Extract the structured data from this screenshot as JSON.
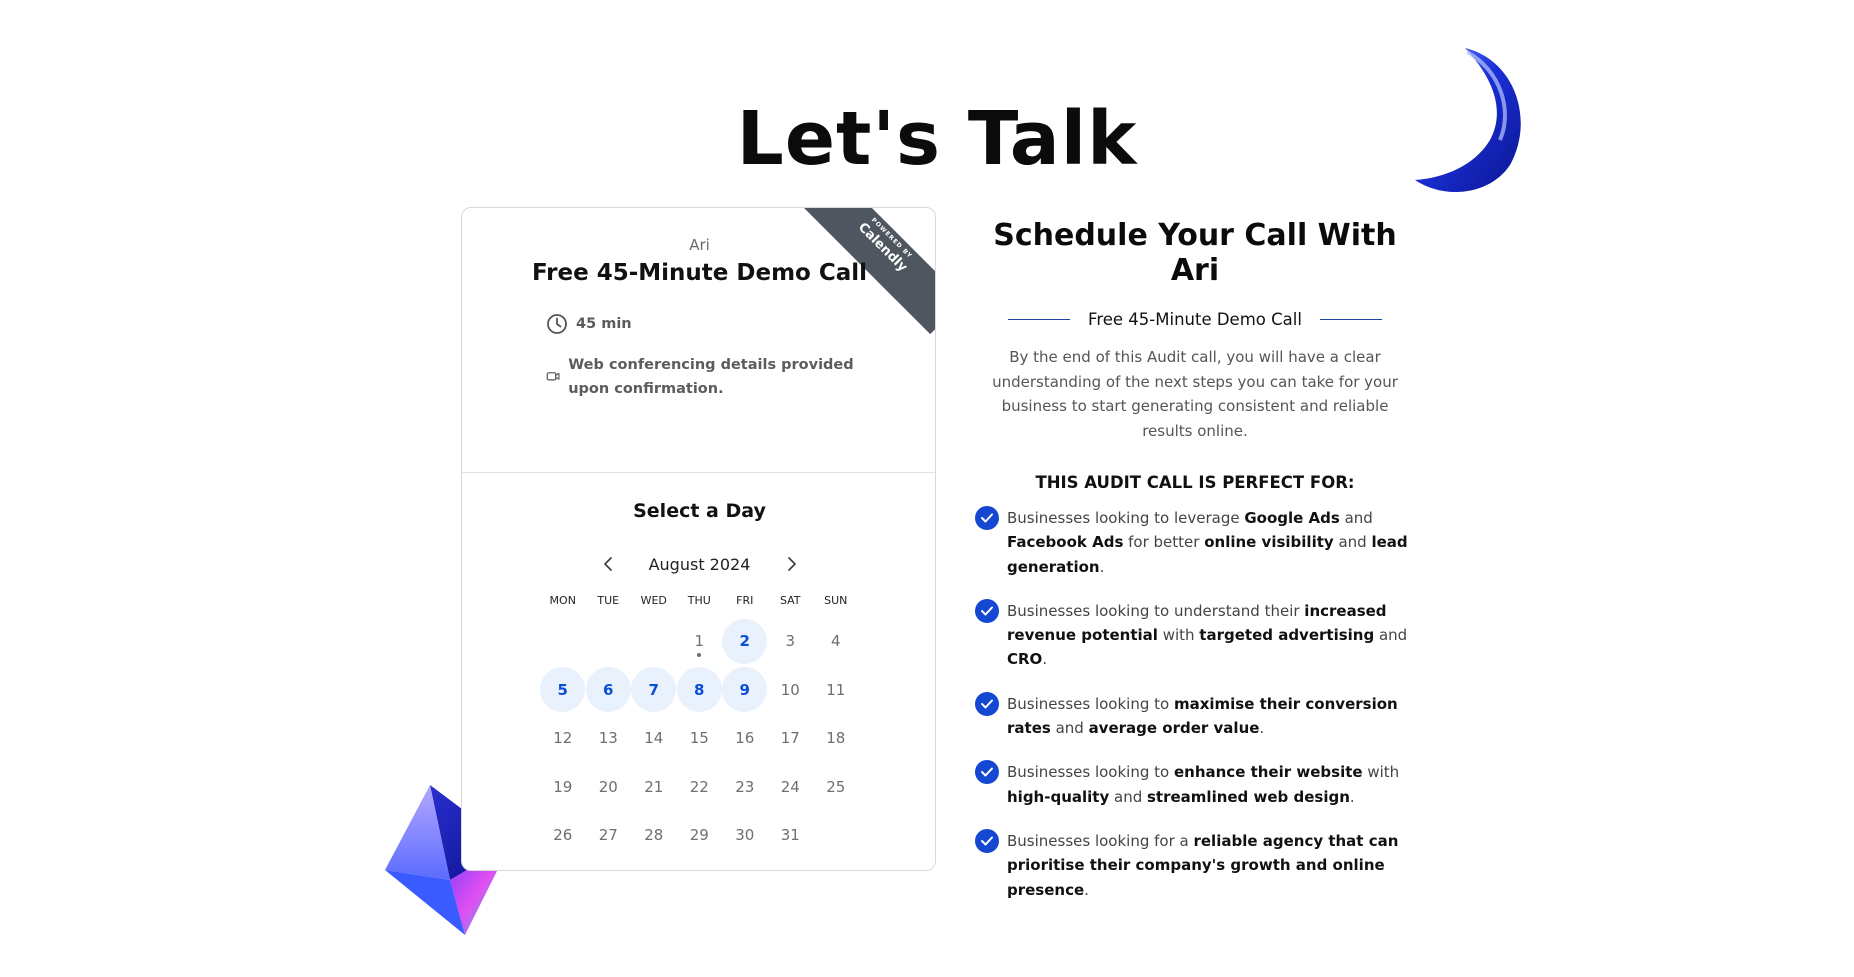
{
  "page": {
    "title": "Let's Talk"
  },
  "colors": {
    "accent": "#1448d2",
    "available_bg": "#e9f1fd",
    "available_text": "#0a4fd6",
    "badge_bg": "#4f5660"
  },
  "calendly": {
    "badge_small": "POWERED BY",
    "badge_brand": "Calendly",
    "host": "Ari",
    "event_title": "Free 45-Minute Demo Call",
    "duration": "45 min",
    "conferencing": "Web conferencing details provided upon confirmation.",
    "select_day": "Select a Day",
    "month": "August 2024",
    "weekdays": [
      "MON",
      "TUE",
      "WED",
      "THU",
      "FRI",
      "SAT",
      "SUN"
    ],
    "weeks": [
      [
        {
          "d": ""
        },
        {
          "d": ""
        },
        {
          "d": ""
        },
        {
          "d": "1",
          "today": true
        },
        {
          "d": "2",
          "available": true
        },
        {
          "d": "3"
        },
        {
          "d": "4"
        }
      ],
      [
        {
          "d": "5",
          "available": true
        },
        {
          "d": "6",
          "available": true
        },
        {
          "d": "7",
          "available": true
        },
        {
          "d": "8",
          "available": true
        },
        {
          "d": "9",
          "available": true
        },
        {
          "d": "10"
        },
        {
          "d": "11"
        }
      ],
      [
        {
          "d": "12"
        },
        {
          "d": "13"
        },
        {
          "d": "14"
        },
        {
          "d": "15"
        },
        {
          "d": "16"
        },
        {
          "d": "17"
        },
        {
          "d": "18"
        }
      ],
      [
        {
          "d": "19"
        },
        {
          "d": "20"
        },
        {
          "d": "21"
        },
        {
          "d": "22"
        },
        {
          "d": "23"
        },
        {
          "d": "24"
        },
        {
          "d": "25"
        }
      ],
      [
        {
          "d": "26"
        },
        {
          "d": "27"
        },
        {
          "d": "28"
        },
        {
          "d": "29"
        },
        {
          "d": "30"
        },
        {
          "d": "31"
        },
        {
          "d": ""
        }
      ]
    ]
  },
  "schedule": {
    "title": "Schedule Your Call With Ari",
    "subtitle": "Free 45-Minute Demo Call",
    "intro": "By the end of this Audit call, you will have a clear understanding of the next steps you can take for your business to start generating consistent and reliable results online.",
    "perfect_for": "THIS AUDIT CALL IS PERFECT FOR:",
    "items": [
      [
        {
          "t": "Businesses looking to leverage "
        },
        {
          "t": "Google Ads",
          "b": true
        },
        {
          "t": " and "
        },
        {
          "t": "Facebook Ads",
          "b": true
        },
        {
          "t": " for better "
        },
        {
          "t": "online visibility",
          "b": true
        },
        {
          "t": " and "
        },
        {
          "t": "lead generation",
          "b": true
        },
        {
          "t": "."
        }
      ],
      [
        {
          "t": "Businesses looking to understand their "
        },
        {
          "t": "increased revenue potential",
          "b": true
        },
        {
          "t": " with "
        },
        {
          "t": "targeted advertising",
          "b": true
        },
        {
          "t": " and "
        },
        {
          "t": "CRO",
          "b": true
        },
        {
          "t": "."
        }
      ],
      [
        {
          "t": "Businesses looking to "
        },
        {
          "t": "maximise their conversion rates",
          "b": true
        },
        {
          "t": " and "
        },
        {
          "t": "average order value",
          "b": true
        },
        {
          "t": "."
        }
      ],
      [
        {
          "t": "Businesses looking to "
        },
        {
          "t": "enhance their website",
          "b": true
        },
        {
          "t": " with "
        },
        {
          "t": "high-quality",
          "b": true
        },
        {
          "t": " and "
        },
        {
          "t": "streamlined web design",
          "b": true
        },
        {
          "t": "."
        }
      ],
      [
        {
          "t": "Businesses looking for a "
        },
        {
          "t": "reliable agency that can prioritise their company's growth and online presence",
          "b": true
        },
        {
          "t": "."
        }
      ]
    ]
  }
}
